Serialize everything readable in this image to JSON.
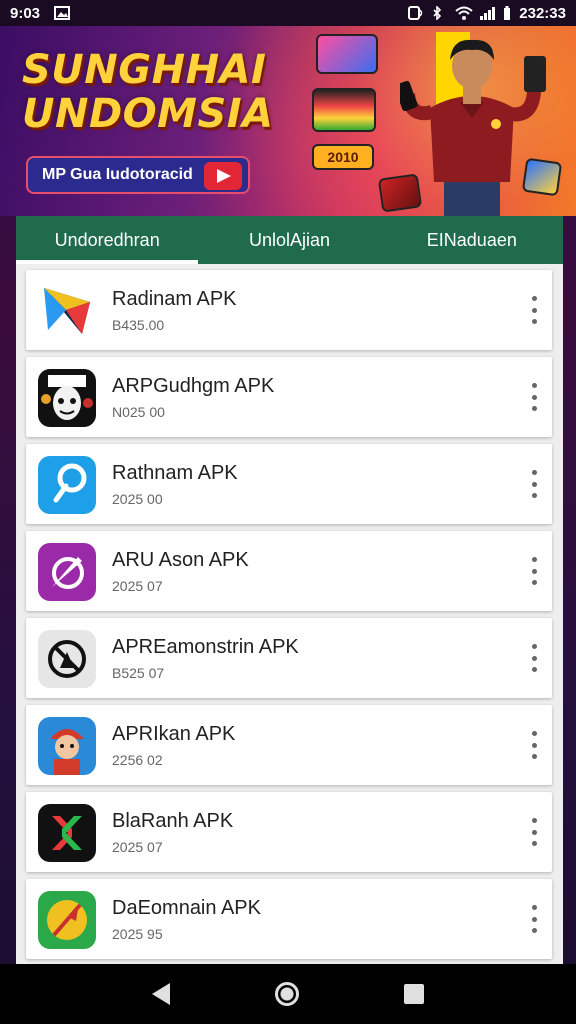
{
  "status_bar": {
    "time": "9:03",
    "clock_right": "232:33",
    "icons": [
      "image-icon",
      "nfc-icon",
      "bluetooth-icon",
      "wifi-icon",
      "signal-icon",
      "battery-icon"
    ]
  },
  "banner": {
    "title_line1": "SUNGHHAI",
    "title_line2": "UNDOMSIA",
    "button_label": "MP Gua Iudotoracid",
    "promo_badge": "2010"
  },
  "tabs": [
    {
      "label": "Undoredhran",
      "active": true
    },
    {
      "label": "UnlolAjian",
      "active": false
    },
    {
      "label": "EINaduaen",
      "active": false
    }
  ],
  "apps": [
    {
      "name": "Radinam APK",
      "meta": "B435.00",
      "icon": "play-triangle-icon"
    },
    {
      "name": "ARPGudhgm APK",
      "meta": "N025 00",
      "icon": "mask-face-icon"
    },
    {
      "name": "Rathnam APK",
      "meta": "2025 00",
      "icon": "pin-icon"
    },
    {
      "name": "ARU Ason APK",
      "meta": "2025 07",
      "icon": "compass-icon"
    },
    {
      "name": "APREamonstrin APK",
      "meta": "B525 07",
      "icon": "blocked-icon"
    },
    {
      "name": "APRIkan APK",
      "meta": "2256 02",
      "icon": "character-icon"
    },
    {
      "name": "BlaRanh APK",
      "meta": "2025 07",
      "icon": "x-logo-icon"
    },
    {
      "name": "DaEomnain APK",
      "meta": "2025 95",
      "icon": "feather-icon"
    }
  ],
  "colors": {
    "tab_bar": "#1f6b4c",
    "banner_title": "#ffd23c",
    "list_bg": "#eeeeee"
  }
}
